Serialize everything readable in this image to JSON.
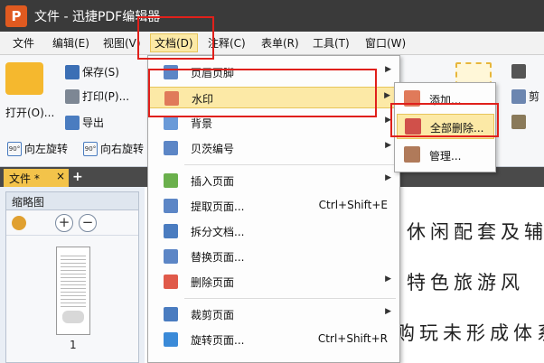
{
  "window": {
    "title": "文件 - 迅捷PDF编辑器",
    "logo": "P"
  },
  "menubar": {
    "items": [
      "文件",
      "编辑(E)",
      "视图(V)",
      "文档(D)",
      "注释(C)",
      "表单(R)",
      "工具(T)",
      "窗口(W)"
    ]
  },
  "ribbon": {
    "open": "打开(O)...",
    "save": "保存(S)",
    "print": "打印(P)...",
    "export": "导出",
    "rotate_left": "向左旋转",
    "rotate_right": "向右旋转",
    "cut_fragment": "剪",
    "rotate_left_glyph": "90°",
    "rotate_right_glyph": "90°"
  },
  "tabs": {
    "doc_tab": "文件 *",
    "close": "×",
    "add": "+"
  },
  "thumbnail_panel": {
    "title": "缩略图",
    "zoom_in": "+",
    "zoom_out": "−",
    "page_number": "1"
  },
  "document": {
    "lines": [
      "休闲配套及辅",
      "特色旅游风",
      "购玩未形成体系"
    ]
  },
  "document_menu": {
    "items": [
      {
        "label": "页眉页脚",
        "shortcut": "",
        "arrow": "▶"
      },
      {
        "label": "水印",
        "shortcut": "",
        "arrow": "▶"
      },
      {
        "label": "背景",
        "shortcut": "",
        "arrow": "▶"
      },
      {
        "label": "贝茨编号",
        "shortcut": "",
        "arrow": "▶"
      },
      {
        "label": "插入页面",
        "shortcut": "",
        "arrow": "▶"
      },
      {
        "label": "提取页面...",
        "shortcut": "Ctrl+Shift+E",
        "arrow": ""
      },
      {
        "label": "拆分文档...",
        "shortcut": "",
        "arrow": ""
      },
      {
        "label": "替换页面...",
        "shortcut": "",
        "arrow": ""
      },
      {
        "label": "删除页面",
        "shortcut": "",
        "arrow": "▶"
      },
      {
        "label": "裁剪页面",
        "shortcut": "",
        "arrow": "▶"
      },
      {
        "label": "旋转页面...",
        "shortcut": "Ctrl+Shift+R",
        "arrow": ""
      }
    ]
  },
  "watermark_submenu": {
    "items": [
      {
        "label": "添加..."
      },
      {
        "label": "全部删除..."
      },
      {
        "label": "管理..."
      }
    ]
  },
  "colors": {
    "accent": "#e0201b",
    "highlight": "#fce9a6",
    "tab_active": "#f3c34a"
  }
}
